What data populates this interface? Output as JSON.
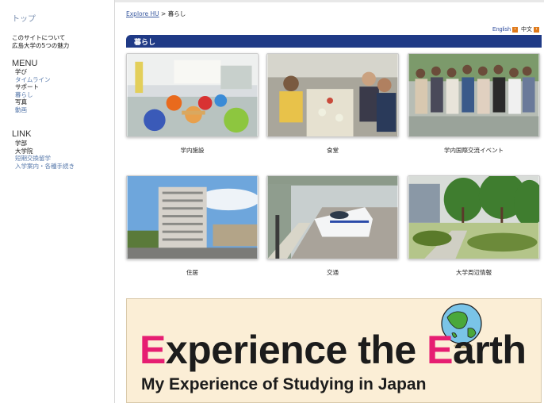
{
  "sidebar": {
    "top_link": "トップ",
    "about_lines": [
      "このサイトについて",
      "広島大学の5つの魅力"
    ],
    "menu_title": "MENU",
    "menu_items": [
      {
        "label": "学び",
        "style": "dark"
      },
      {
        "label": "タイムライン",
        "style": "blue"
      },
      {
        "label": "サポート",
        "style": "dark"
      },
      {
        "label": "暮らし",
        "style": "blue"
      },
      {
        "label": "写真",
        "style": "dark"
      },
      {
        "label": "動画",
        "style": "blue"
      }
    ],
    "link_title": "LINK",
    "link_items": [
      {
        "label": "学部",
        "style": "dark"
      },
      {
        "label": "大学院",
        "style": "dark"
      },
      {
        "label": "短期交換留学",
        "style": "blue"
      },
      {
        "label": "入学案内・各種手続き",
        "style": "blue"
      }
    ]
  },
  "breadcrumb": {
    "parent": "Explore HU",
    "separator": " > ",
    "current": "暮らし"
  },
  "language": {
    "english": "English",
    "chinese": "中文",
    "arrow_glyph": "›"
  },
  "section": {
    "title": "暮らし",
    "bar_color": "#1f3a86"
  },
  "tiles": [
    {
      "caption": "学内施設"
    },
    {
      "caption": "食堂"
    },
    {
      "caption": "学内国際交流イベント"
    },
    {
      "caption": "住居"
    },
    {
      "caption": "交通"
    },
    {
      "caption": "大学周辺情報"
    }
  ],
  "banner": {
    "headline_parts": [
      "E",
      "xperience the ",
      "E",
      "arth"
    ],
    "subline": "My Experience of Studying in Japan",
    "accent_color": "#e61e72"
  }
}
